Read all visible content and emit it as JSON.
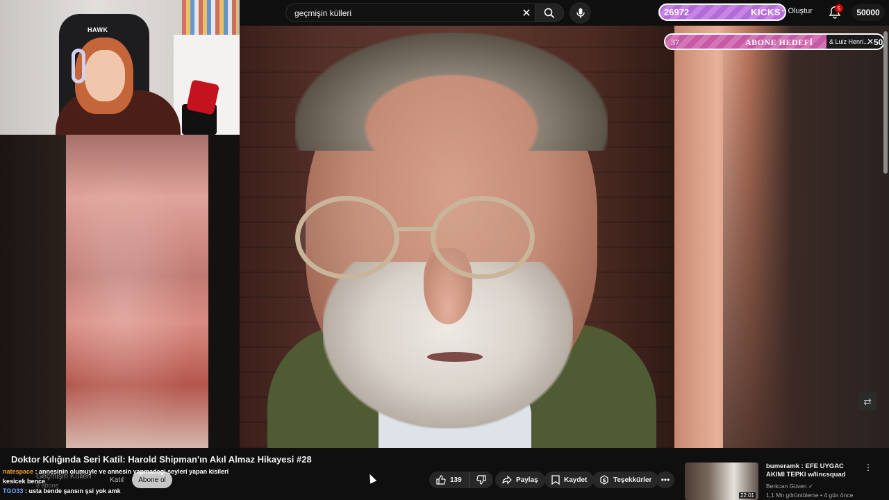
{
  "search": {
    "query": "geçmişin külleri"
  },
  "top_overlay": {
    "kicks_count": "26972",
    "kicks_label": "KICKS",
    "create_label": "Oluştur",
    "notification_count": "5",
    "goal_total": "50000"
  },
  "sub_goal": {
    "current": "37",
    "label": "ABONE HEDEFİ",
    "recent_user": "& Luiz Henri...",
    "target": "50",
    "progress_fraction": 0.74
  },
  "webcam": {
    "chair_brand": "HAWK"
  },
  "video": {
    "title": "Doktor Kılığında Seri Katil: Harold Shipman'ın Akıl Almaz Hikayesi #28",
    "channel_name": "Geçmişin Külleri",
    "subscribers": "8 abone",
    "join_label": "Katıl",
    "subscribe_label": "Abone ol",
    "like_count": "139",
    "share_label": "Paylaş",
    "save_label": "Kaydet",
    "thanks_label": "Teşekkürler"
  },
  "chat": [
    {
      "user": "natespace",
      "message": ": annesinin olumuyle ve annesin yapmadegi seyleri yapan kisileri kesicek bence"
    },
    {
      "user": "TGO33",
      "message": ": usta bende şansın şsi yok amk"
    }
  ],
  "recommendation": {
    "title": "bumeramk : EFE UYGAC AKIMI TEPKI w/lincsquad",
    "channel": "Berkcan Güven",
    "meta": "1,1 Mn görüntüleme • 4 gün önce",
    "duration": "22:01"
  }
}
